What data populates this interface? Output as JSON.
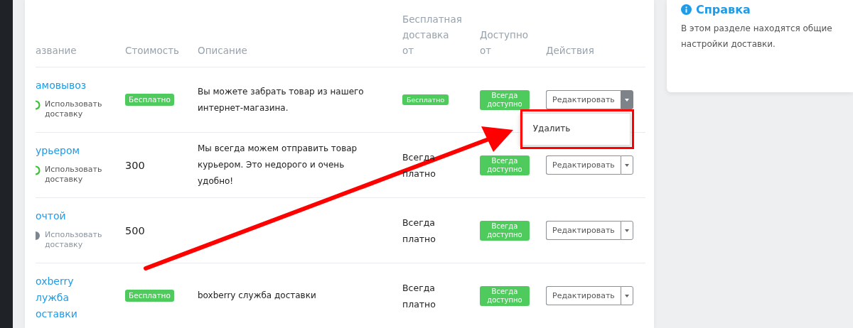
{
  "table": {
    "columns": [
      "азвание",
      "Стоимость",
      "Описание",
      "Бесплатная доставка от",
      "Доступно от",
      "Действия"
    ],
    "rows": [
      {
        "name_lines": [
          "амовывоз"
        ],
        "toggle": {
          "label": "Использовать доставку",
          "on": true
        },
        "cost": {
          "kind": "badge",
          "text": "Бесплатно"
        },
        "description": "Вы можете забрать товар из нашего интернет-магазина.",
        "free_from": {
          "kind": "badge",
          "text": "Бесплатно"
        },
        "available": "Всегда доступно",
        "edit": "Редактировать",
        "menu_open": true
      },
      {
        "name_lines": [
          "урьером"
        ],
        "toggle": {
          "label": "Использовать доставку",
          "on": true
        },
        "cost": {
          "kind": "text",
          "text": "300"
        },
        "description": "Мы всегда можем отправить товар курьером. Это недорого и очень удобно!",
        "free_from": {
          "kind": "text",
          "text": "Всегда платно"
        },
        "available": "Всегда доступно",
        "edit": "Редактировать",
        "menu_open": false
      },
      {
        "name_lines": [
          "очтой"
        ],
        "toggle": {
          "label": "Использовать доставку",
          "on": false
        },
        "cost": {
          "kind": "text",
          "text": "500"
        },
        "free_from": {
          "kind": "text",
          "text": "Всегда платно"
        },
        "available": "Всегда доступно",
        "edit": "Редактировать",
        "menu_open": false
      },
      {
        "name_lines": [
          "oxberry",
          "лужба",
          "оставки"
        ],
        "cost": {
          "kind": "badge",
          "text": "Бесплатно"
        },
        "description": "boxberry служба доставки",
        "free_from": {
          "kind": "text",
          "text": "Всегда платно"
        },
        "available": "Всегда доступно",
        "edit": "Редактировать",
        "menu_open": false
      }
    ]
  },
  "dropdown_menu": {
    "items": [
      "Удалить"
    ]
  },
  "help": {
    "title": "Справка",
    "text": "В этом разделе находятся общие настройки доставки."
  }
}
